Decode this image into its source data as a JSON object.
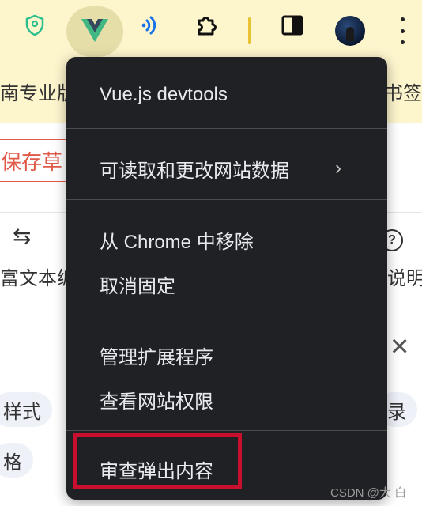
{
  "toolbar": {
    "icons": [
      "shield-location-icon",
      "vue-devtools-icon",
      "wifi-signal-icon",
      "puzzle-extensions-icon",
      "side-panel-icon",
      "avatar",
      "more-vertical-icon"
    ]
  },
  "bookmarks": {
    "left_text": "南专业版",
    "right_text": "书签"
  },
  "page": {
    "draft_button": "保存草",
    "rich_text_label": "富文本编",
    "help_label": "说明",
    "chips": [
      "样式",
      "格",
      "录"
    ]
  },
  "menu": {
    "title": "Vue.js devtools",
    "site_data": "可读取和更改网站数据",
    "remove": "从 Chrome 中移除",
    "unpin": "取消固定",
    "manage": "管理扩展程序",
    "view_permissions": "查看网站权限",
    "inspect_popup": "审查弹出内容"
  },
  "watermark": "CSDN @大 白",
  "colors": {
    "toolbar_bg": "#fdf5cc",
    "menu_bg": "#202124",
    "menu_text": "#e8eaed",
    "highlight": "#c8102e",
    "vue_green": "#41b883",
    "vue_dark": "#35495e"
  }
}
